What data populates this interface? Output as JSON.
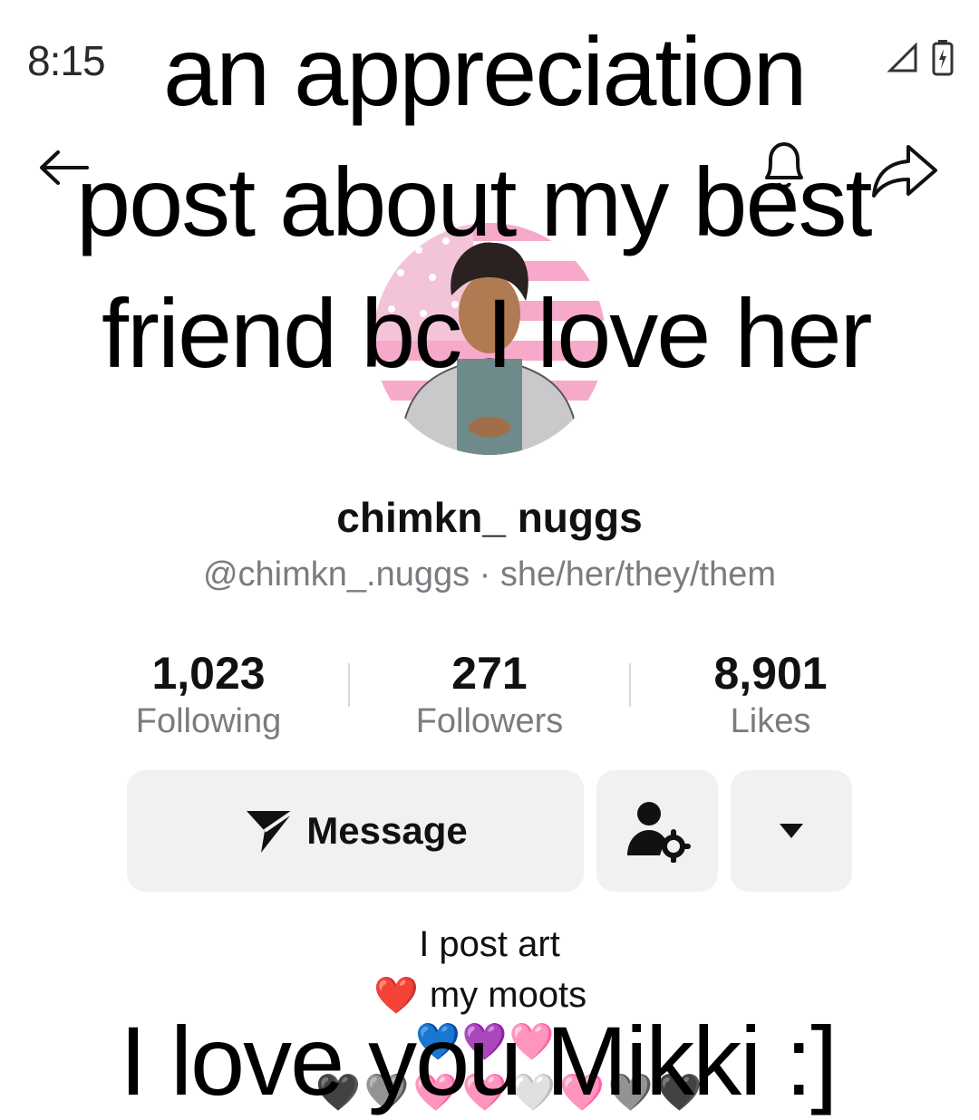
{
  "status_bar": {
    "time": "8:15"
  },
  "overlay": {
    "line1": "an appreciation",
    "line2": "post about my best",
    "line3": "friend bc I love her",
    "bottom": "I love you Mikki :]"
  },
  "profile": {
    "display_name": "chimkn_ nuggs",
    "handle_line": "@chimkn_.nuggs · she/her/they/them",
    "stats": [
      {
        "value": "1,023",
        "label": "Following"
      },
      {
        "value": "271",
        "label": "Followers"
      },
      {
        "value": "8,901",
        "label": "Likes"
      }
    ],
    "message_label": "Message",
    "bio": {
      "line1": "I post art",
      "line2_heart": "❤️",
      "line2_text": "my moots",
      "line3": [
        "💙",
        "💜",
        "🩷"
      ],
      "line4": [
        "🖤",
        "🩶",
        "🩷",
        "🩷",
        "🤍",
        "🩷",
        "🩶",
        "🖤"
      ]
    }
  },
  "icons": [
    "back-arrow-icon",
    "bell-icon",
    "share-icon",
    "message-icon",
    "add-friend-settings-icon",
    "dropdown-icon"
  ],
  "colors": {
    "accent": "#161823",
    "muted": "#7b7b80",
    "button_bg": "#f1f1f2"
  }
}
